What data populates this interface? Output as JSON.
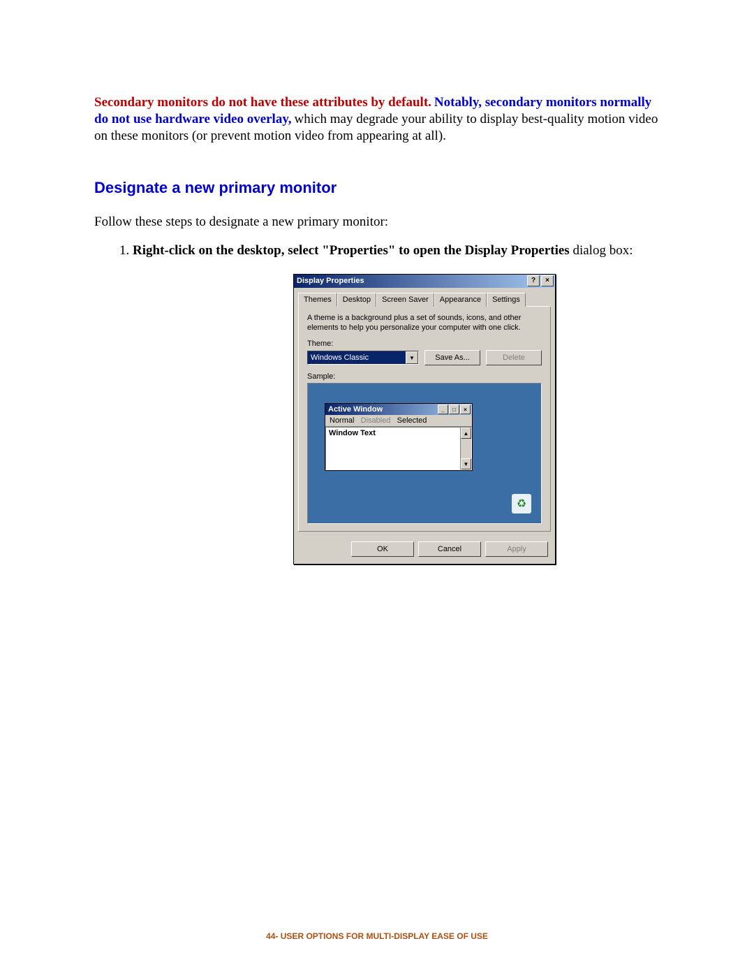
{
  "intro": {
    "red": "Secondary monitors do not have these attributes by default.",
    "blue": " Notably, secondary monitors normally do not use hardware video overlay,",
    "black": " which may degrade your ability to display best-quality motion video on these monitors (or prevent motion video from appearing at all)."
  },
  "heading": "Designate a new primary monitor",
  "follow": "Follow these steps to designate a new primary monitor:",
  "step1": {
    "number": "1.",
    "bold": "Right-click on the desktop, select \"Properties\" to open the Display Properties",
    "rest": " dialog box:"
  },
  "dialog": {
    "title": "Display Properties",
    "help": "?",
    "close": "×",
    "tabs": [
      "Themes",
      "Desktop",
      "Screen Saver",
      "Appearance",
      "Settings"
    ],
    "description": "A theme is a background plus a set of sounds, icons, and other elements to help you personalize your computer with one click.",
    "theme_label": "Theme:",
    "theme_value": "Windows Classic",
    "save_as": "Save As...",
    "delete": "Delete",
    "sample_label": "Sample:",
    "active_window": {
      "title": "Active Window",
      "menu_normal": "Normal",
      "menu_disabled": "Disabled",
      "menu_selected": "Selected",
      "body_text": "Window Text"
    },
    "ok": "OK",
    "cancel": "Cancel",
    "apply": "Apply"
  },
  "footer": {
    "page": "44-",
    "text": " USER OPTIONS FOR MULTI-DISPLAY EASE OF USE"
  }
}
